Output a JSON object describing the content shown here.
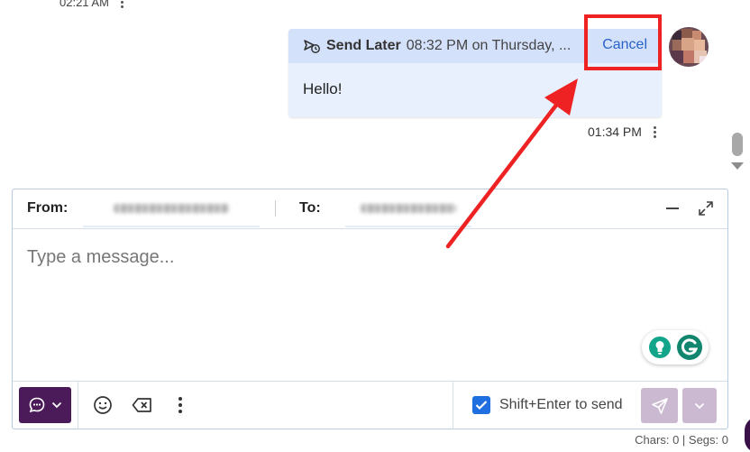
{
  "previous_message": {
    "time": "02:21 AM"
  },
  "message": {
    "scheduled_label": "Send Later",
    "scheduled_detail": "08:32 PM on Thursday, ...",
    "cancel_label": "Cancel",
    "body": "Hello!",
    "time": "01:34 PM"
  },
  "composer": {
    "from_label": "From:",
    "to_label": "To:",
    "placeholder": "Type a message...",
    "shift_enter_label": "Shift+Enter to send",
    "shift_enter_checked": true
  },
  "counter": "Chars: 0 | Segs: 0",
  "icons": {
    "send_later": "clock-send-icon",
    "chat_type": "chat-bubble-icon",
    "emoji": "smiley-icon",
    "clear": "backspace-icon",
    "more": "kebab-icon",
    "send": "paper-plane-icon",
    "send_options": "chevron-down-icon",
    "grammarly_tip": "lightbulb-icon",
    "grammarly": "grammarly-g-icon",
    "minimize": "minimize-icon",
    "expand": "expand-icon"
  },
  "colors": {
    "accent": "#2962c8",
    "highlight": "#ee2222",
    "message_bg": "#e8f0fe",
    "header_bg": "#d4e1fb",
    "brand_purple": "#4b1a59",
    "send_disabled": "#cbb9d2",
    "checkbox": "#1f6fe0"
  }
}
